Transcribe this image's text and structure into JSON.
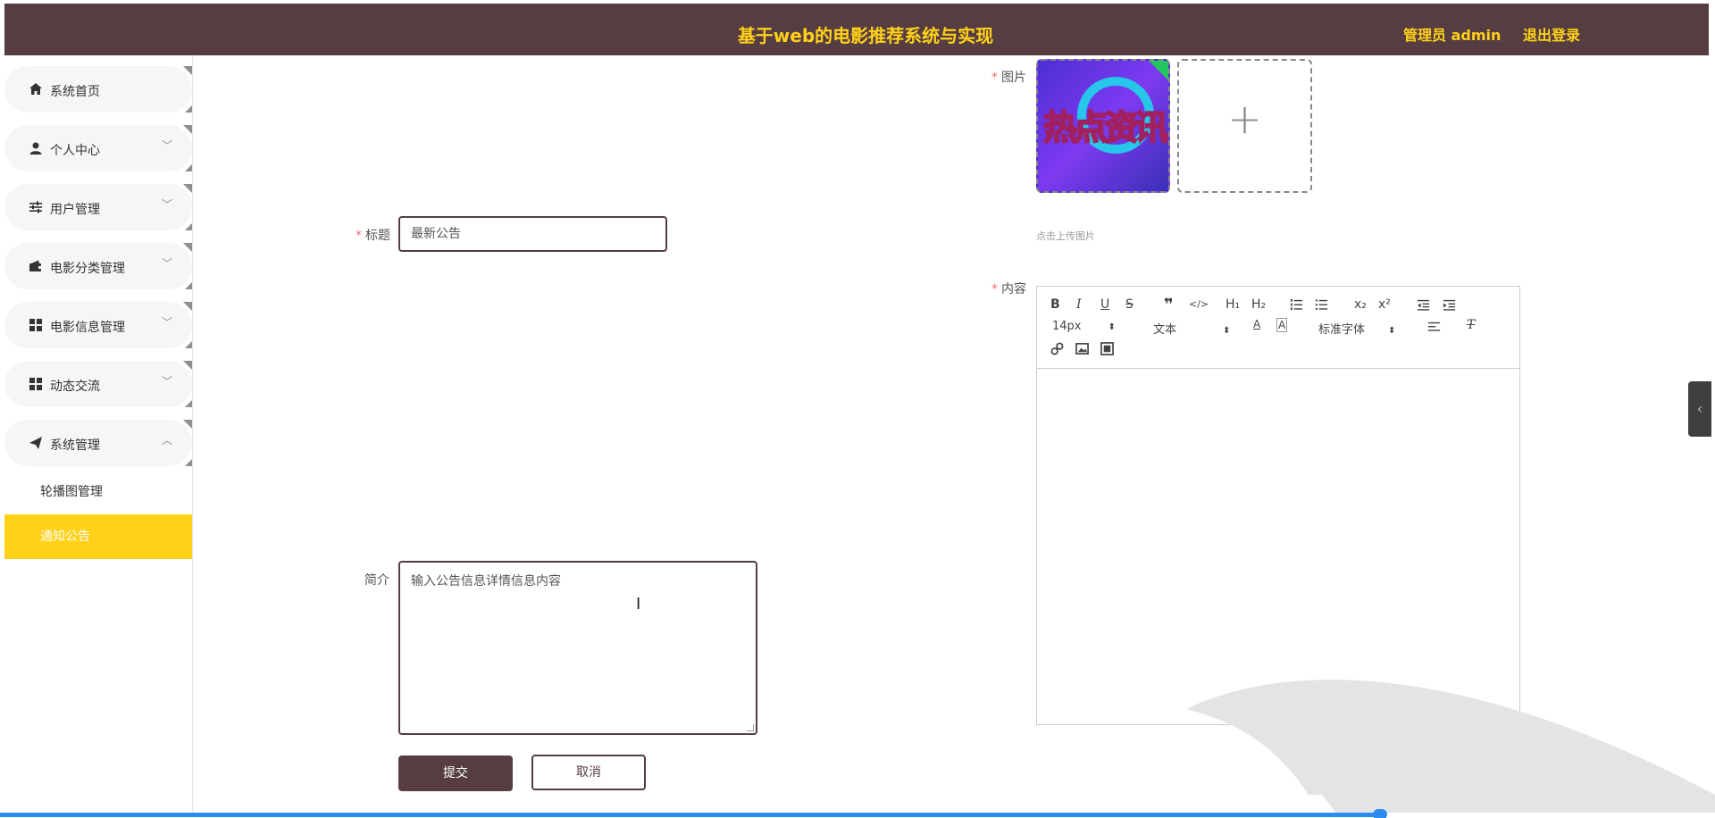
{
  "header": {
    "title": "基于web的电影推荐系统与实现",
    "user": "管理员 admin",
    "logout": "退出登录"
  },
  "sidebar": {
    "items": [
      {
        "label": "系统首页",
        "icon": "home-icon"
      },
      {
        "label": "个人中心",
        "icon": "user-icon"
      },
      {
        "label": "用户管理",
        "icon": "sliders-icon"
      },
      {
        "label": "电影分类管理",
        "icon": "wallet-icon"
      },
      {
        "label": "电影信息管理",
        "icon": "grid-icon"
      },
      {
        "label": "动态交流",
        "icon": "grid-icon"
      },
      {
        "label": "系统管理",
        "icon": "send-icon"
      }
    ],
    "sub_items": [
      {
        "label": "轮播图管理"
      },
      {
        "label": "通知公告"
      }
    ]
  },
  "form": {
    "title_label": "标题",
    "title_value": "最新公告",
    "intro_label": "简介",
    "intro_value": "输入公告信息详情信息内容",
    "image_label": "图片",
    "image_text": "热点资讯",
    "upload_tip": "点击上传图片",
    "content_label": "内容",
    "submit_label": "提交",
    "cancel_label": "取消",
    "required_mark": "*"
  },
  "editor": {
    "toolbar_row1": [
      "B",
      "I",
      "U",
      "S",
      "❞",
      "</>",
      "H1",
      "H2",
      "ol",
      "ul",
      "x₂",
      "x²",
      "outdent",
      "indent"
    ],
    "font_size": "14px",
    "block_type": "文本",
    "font_family": "标准字体",
    "h1": "H₁",
    "h2": "H₂",
    "sub": "x₂",
    "sup": "x²"
  },
  "colors": {
    "header_bg": "#553d41",
    "header_text": "#ffd119",
    "active_item": "#ffd119",
    "progress": "#2d8cf0"
  }
}
